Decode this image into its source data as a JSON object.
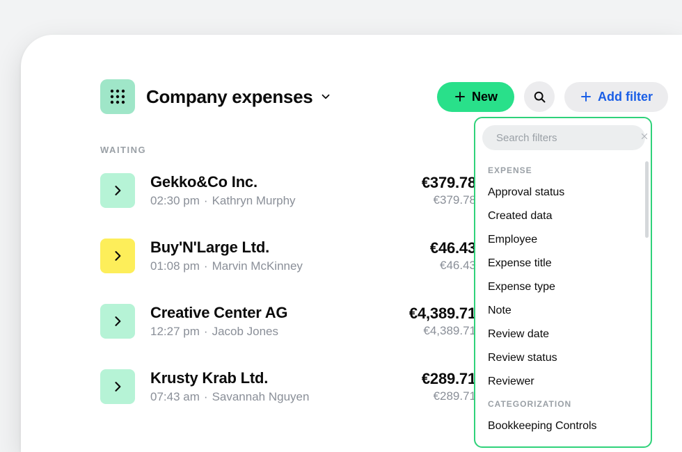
{
  "header": {
    "title": "Company expenses",
    "new_label": "New",
    "add_filter_label": "Add filter"
  },
  "section_label": "WAITING",
  "rows": [
    {
      "color": "green",
      "title": "Gekko&Co Inc.",
      "time": "02:30 pm",
      "person": "Kathryn Murphy",
      "amount": "€379.78",
      "amount2": "€379.78"
    },
    {
      "color": "yellow",
      "title": "Buy'N'Large Ltd.",
      "time": "01:08 pm",
      "person": "Marvin McKinney",
      "amount": "€46.43",
      "amount2": "€46.43"
    },
    {
      "color": "green",
      "title": "Creative Center AG",
      "time": "12:27 pm",
      "person": "Jacob Jones",
      "amount": "€4,389.71",
      "amount2": "€4,389.71"
    },
    {
      "color": "green",
      "title": "Krusty Krab Ltd.",
      "time": "07:43 am",
      "person": "Savannah Nguyen",
      "amount": "€289.71",
      "amount2": "€289.71"
    }
  ],
  "filter_popover": {
    "search_placeholder": "Search filters",
    "groups": [
      {
        "label": "EXPENSE",
        "items": [
          "Approval status",
          "Created data",
          "Employee",
          "Expense title",
          "Expense type",
          "Note",
          "Review date",
          "Review status",
          "Reviewer"
        ]
      },
      {
        "label": "CATEGORIZATION",
        "items": [
          "Bookkeeping Controls"
        ]
      }
    ]
  }
}
